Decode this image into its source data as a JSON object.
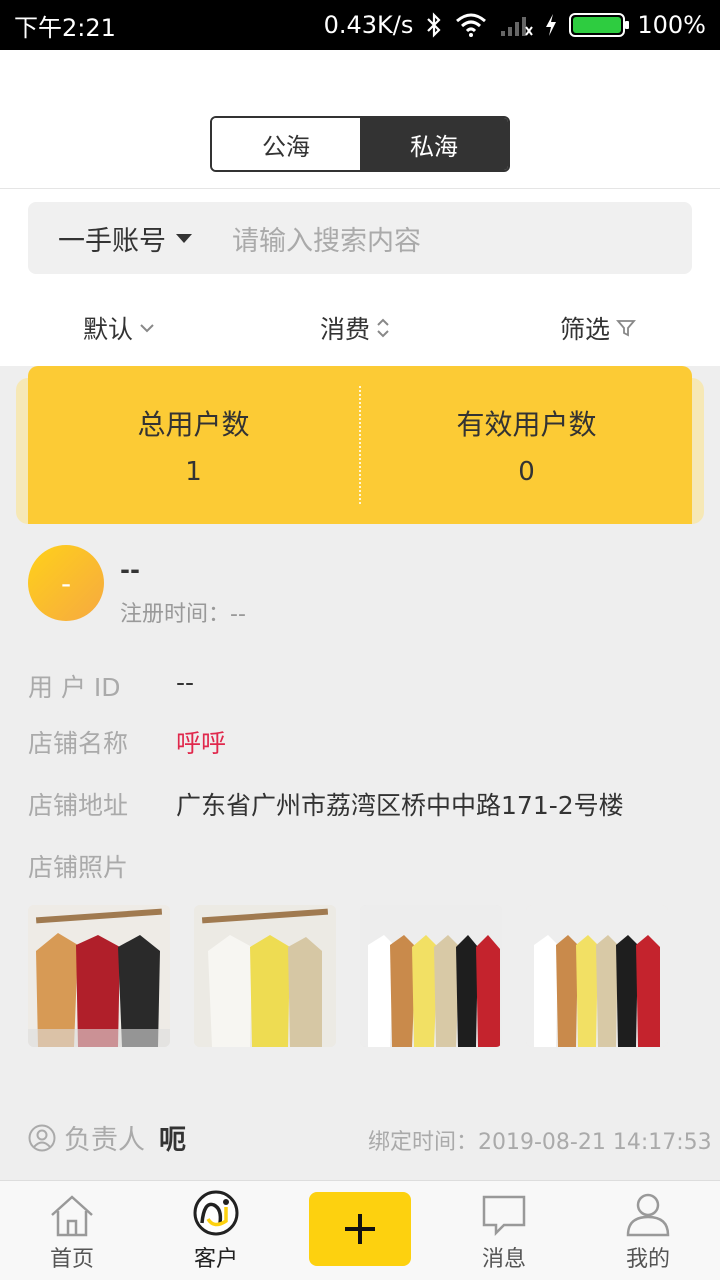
{
  "status_bar": {
    "time": "下午2:21",
    "network_speed": "0.43K/s",
    "battery_percent": "100%"
  },
  "segmented": {
    "options": [
      "公海",
      "私海"
    ],
    "selected": "私海"
  },
  "search": {
    "type_label": "一手账号",
    "placeholder": "请输入搜索内容"
  },
  "sort_bar": {
    "default_label": "默认",
    "spend_label": "消费",
    "filter_label": "筛选"
  },
  "stats": {
    "total_users_label": "总用户数",
    "total_users_value": "1",
    "valid_users_label": "有效用户数",
    "valid_users_value": "0"
  },
  "user": {
    "avatar_text": "-",
    "name": "--",
    "reg_time": "注册时间：--",
    "user_id_label": "用 户 ID",
    "user_id_value": "--",
    "shop_name_label": "店铺名称",
    "shop_name_value": "呼呼",
    "shop_address_label": "店铺地址",
    "shop_address_value": "广东省广州市荔湾区桥中中路171-2号楼",
    "shop_photos_label": "店铺照片",
    "owner_label": "负责人",
    "owner_name": "呃",
    "bind_time": "绑定时间：2019-08-21 14:17:53"
  },
  "tabbar": {
    "home": "首页",
    "customers": "客户",
    "messages": "消息",
    "mine": "我的"
  },
  "colors": {
    "accent_yellow": "#fccb35",
    "highlight_red": "#e0284c",
    "dark": "#333333"
  }
}
